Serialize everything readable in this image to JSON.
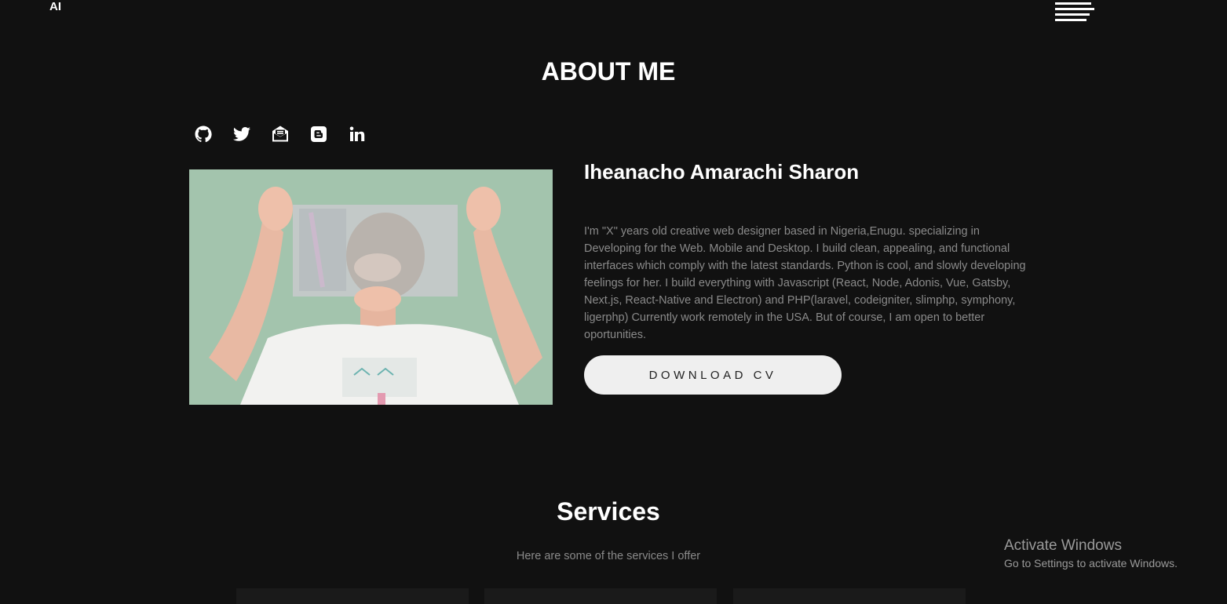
{
  "header": {
    "logo": "AI",
    "menu_icon": "hamburger-menu-icon"
  },
  "about": {
    "title": "ABOUT ME",
    "social_links": [
      {
        "icon": "github-icon"
      },
      {
        "icon": "twitter-icon"
      },
      {
        "icon": "envelope-open-icon"
      },
      {
        "icon": "blogger-icon"
      },
      {
        "icon": "linkedin-icon"
      }
    ],
    "name": "Iheanacho Amarachi Sharon",
    "bio": "I'm \"X\" years old creative web designer based in Nigeria,Enugu. specializing in Developing for the Web. Mobile and Desktop. I build clean, appealing, and functional interfaces which comply with the latest standards. Python is cool, and slowly developing feelings for her. I build everything with Javascript (React, Node, Adonis, Vue, Gatsby, Next.js, React-Native and Electron) and PHP(laravel, codeigniter, slimphp, symphony, ligerphp) Currently work remotely in the USA. But of course, I am open to better oportunities.",
    "cv_button": "DOWNLOAD CV"
  },
  "services": {
    "title": "Services",
    "subtitle": "Here are some of the services I offer"
  },
  "watermark": {
    "title": "Activate Windows",
    "subtitle": "Go to Settings to activate Windows."
  },
  "colors": {
    "background": "#111111",
    "text": "#ffffff",
    "muted": "#8a8a8a",
    "button_bg": "#efefef",
    "photo_bg": "#a3c4ad"
  }
}
